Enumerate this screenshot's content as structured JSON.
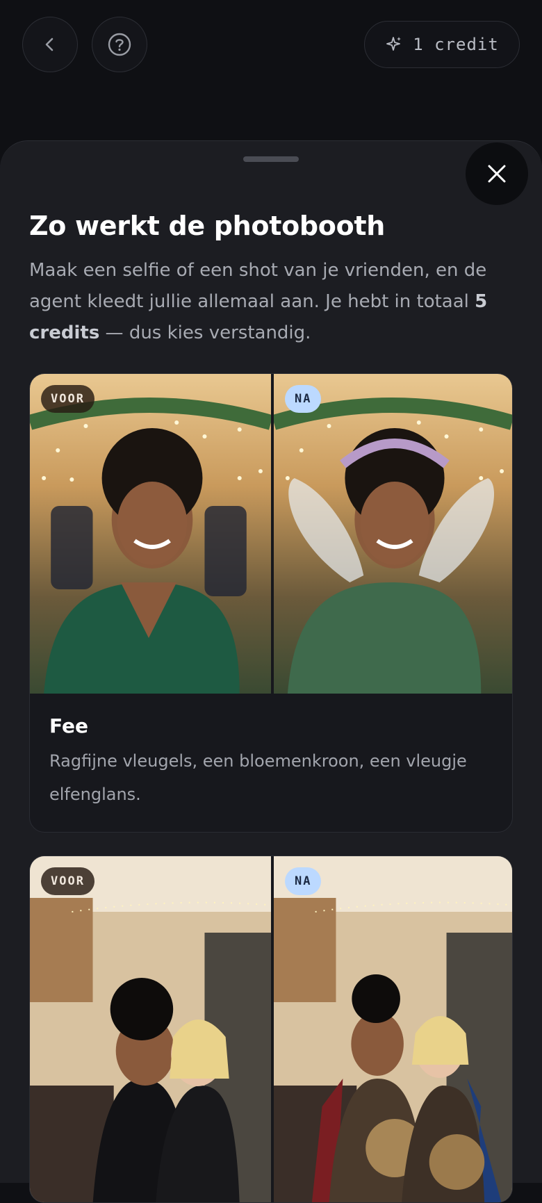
{
  "header": {
    "back_icon": "chevron-left-icon",
    "help_icon": "question-circle-icon",
    "credit_icon": "sparkle-icon",
    "credit_label": "1 credit"
  },
  "sheet": {
    "close_icon": "close-icon",
    "title": "Zo werkt de photobooth",
    "description_pre": "Maak een selfie of een shot van je vrienden, en de agent kleedt jullie allemaal aan. Je hebt in totaal ",
    "description_bold": "5 credits",
    "description_post": " — dus kies verstandig."
  },
  "examples": [
    {
      "before_label": "VOOR",
      "after_label": "NA",
      "title": "Fee",
      "text": "Ragfijne vleugels, een bloemenkroon, een vleugje elfenglans."
    },
    {
      "before_label": "VOOR",
      "after_label": "NA"
    }
  ],
  "colors": {
    "background": "#0f1014",
    "sheet": "#1c1d22",
    "badge_na": "#bcd9ff",
    "badge_voor": "#3a2a1e"
  }
}
